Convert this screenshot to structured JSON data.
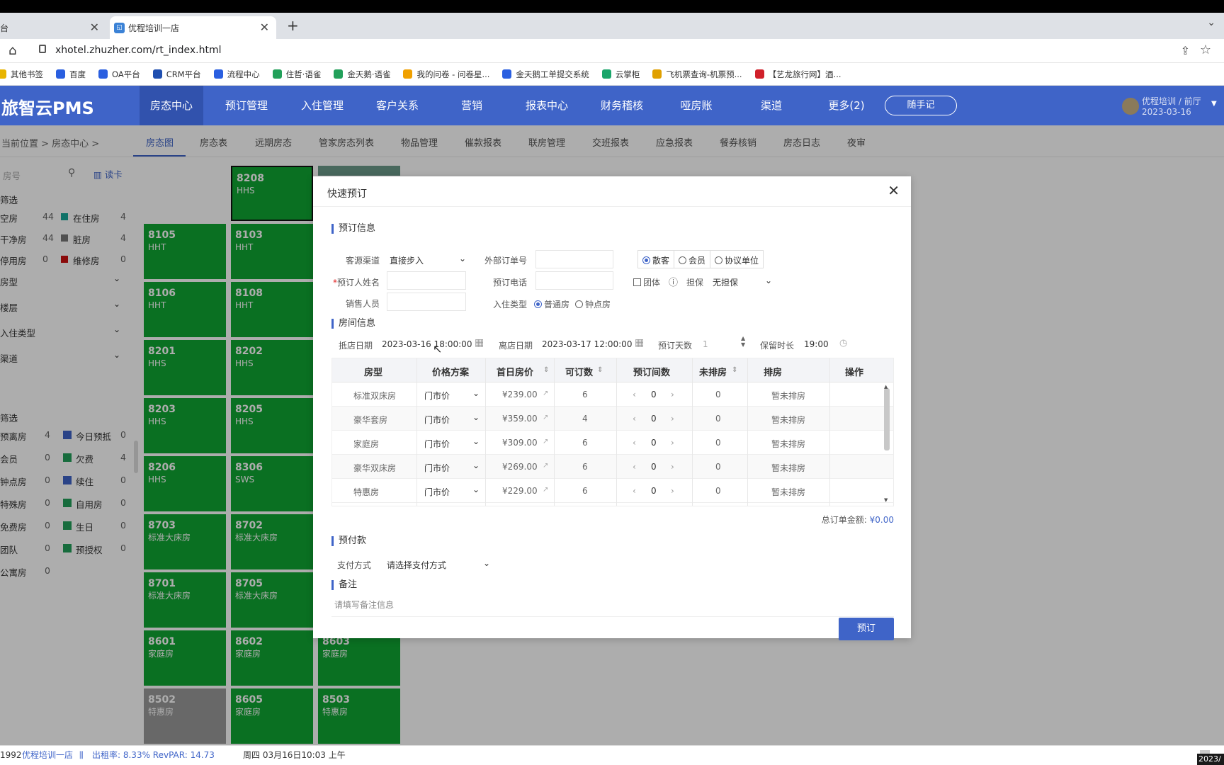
{
  "browser": {
    "tabs": [
      {
        "label": "台",
        "active": false
      },
      {
        "label": "优程培训一店",
        "active": true
      }
    ],
    "new_tab": "+",
    "url": "xhotel.zhuzher.com/rt_index.html",
    "bookmarks": [
      {
        "label": "其他书签",
        "color": "#e8b400"
      },
      {
        "label": "百度",
        "color": "#2a5fe0"
      },
      {
        "label": "OA平台",
        "color": "#2a5fe0"
      },
      {
        "label": "CRM平台",
        "color": "#1f4fb0"
      },
      {
        "label": "流程中心",
        "color": "#2a5fe0"
      },
      {
        "label": "住哲·语雀",
        "color": "#22a05a"
      },
      {
        "label": "金天鹅·语雀",
        "color": "#22a05a"
      },
      {
        "label": "我的问卷 - 问卷星...",
        "color": "#f0a000"
      },
      {
        "label": "金天鹅工单提交系统",
        "color": "#2a5fe0"
      },
      {
        "label": "云掌柜",
        "color": "#1aa56a"
      },
      {
        "label": "飞机票查询-机票预...",
        "color": "#e0a000"
      },
      {
        "label": "【艺龙旅行网】酒...",
        "color": "#d0202a"
      }
    ]
  },
  "app": {
    "logo": "旅智云PMS",
    "nav": [
      "房态中心",
      "预订管理",
      "入住管理",
      "客户关系",
      "营销",
      "报表中心",
      "财务稽核",
      "哑房账",
      "渠道",
      "更多(2)"
    ],
    "memo_button": "随手记",
    "user_name": "优程培训 / 前厅",
    "user_date": "2023-03-16",
    "breadcrumb": "当前位置 > 房态中心 >",
    "subtabs": [
      "房态图",
      "房态表",
      "远期房态",
      "管家房态列表",
      "物品管理",
      "催款报表",
      "联房管理",
      "交班报表",
      "应急报表",
      "餐券核销",
      "房态日志",
      "夜审"
    ]
  },
  "left_panel": {
    "search_placeholder": "房号",
    "card_label": "读卡",
    "filter_title": "筛选",
    "status_rows": [
      {
        "label": "空房",
        "count": "44",
        "label2": "在住房",
        "count2": "4",
        "color2": "#17a89a"
      },
      {
        "label": "干净房",
        "count": "44",
        "label2": "脏房",
        "count2": "4",
        "color2": "#777777"
      },
      {
        "label": "停用房",
        "count": "0",
        "label2": "维修房",
        "count2": "0",
        "color2": "#cc1010"
      }
    ],
    "collapse_sections": [
      "房型",
      "楼层",
      "入住类型",
      "渠道"
    ],
    "filter2_title": "筛选",
    "filter_rows": [
      {
        "label": "预离房",
        "count": "4",
        "label2": "今日预抵",
        "count2": "0"
      },
      {
        "label": "会员",
        "count": "0",
        "label2": "欠费",
        "count2": "4"
      },
      {
        "label": "钟点房",
        "count": "0",
        "label2": "续住",
        "count2": "0"
      },
      {
        "label": "特殊房",
        "count": "0",
        "label2": "自用房",
        "count2": "0"
      },
      {
        "label": "免费房",
        "count": "0",
        "label2": "生日",
        "count2": "0"
      },
      {
        "label": "团队",
        "count": "0",
        "label2": "预授权",
        "count2": "0"
      },
      {
        "label": "公寓房",
        "count": "0",
        "label2": "",
        "count2": ""
      }
    ]
  },
  "rooms": [
    {
      "no": "8208",
      "type": "HHS"
    },
    {
      "no": "8105",
      "type": "HHT"
    },
    {
      "no": "8103",
      "type": "HHT"
    },
    {
      "no": "8106",
      "type": "HHT"
    },
    {
      "no": "8108",
      "type": "HHT"
    },
    {
      "no": "8201",
      "type": "HHS"
    },
    {
      "no": "8202",
      "type": "HHS"
    },
    {
      "no": "8203",
      "type": "HHS"
    },
    {
      "no": "8205",
      "type": "HHS"
    },
    {
      "no": "8206",
      "type": "HHS"
    },
    {
      "no": "8306",
      "type": "SWS"
    },
    {
      "no": "8703",
      "type": "标准大床房"
    },
    {
      "no": "8702",
      "type": "标准大床房"
    },
    {
      "no": "8701",
      "type": "标准大床房"
    },
    {
      "no": "8705",
      "type": "标准大床房"
    },
    {
      "no": "8601",
      "type": "家庭房"
    },
    {
      "no": "8602",
      "type": "家庭房"
    },
    {
      "no": "8603",
      "type": "家庭房"
    },
    {
      "no": "8502",
      "type": "特惠房"
    },
    {
      "no": "8605",
      "type": "家庭房"
    },
    {
      "no": "8503",
      "type": "特惠房"
    }
  ],
  "dialog": {
    "title": "快速预订",
    "sec_booking": "预订信息",
    "source_label": "客源渠道",
    "source_value": "直接步入",
    "ext_order_label": "外部订单号",
    "guest_types": [
      "散客",
      "会员",
      "协议单位"
    ],
    "booker_label": "预订人姓名",
    "phone_label": "预订电话",
    "group_label": "团体",
    "guarantee_label": "担保",
    "guarantee_value": "无担保",
    "sales_label": "销售人员",
    "checkin_type_label": "入住类型",
    "checkin_types": [
      "普通房",
      "钟点房"
    ],
    "sec_room": "房间信息",
    "arrive_label": "抵店日期",
    "arrive_value": "2023-03-16 18:00:00",
    "depart_label": "离店日期",
    "depart_value": "2023-03-17 12:00:00",
    "days_label": "预订天数",
    "days_value": "1",
    "hold_label": "保留时长",
    "hold_value": "19:00",
    "columns": [
      "房型",
      "价格方案",
      "首日房价",
      "可订数",
      "预订间数",
      "未排房",
      "排房",
      "操作"
    ],
    "rows": [
      {
        "type": "标准双床房",
        "plan": "门市价",
        "price": "¥239.00",
        "avail": "6",
        "qty": "0",
        "unassigned": "0",
        "assign": "暂未排房"
      },
      {
        "type": "豪华套房",
        "plan": "门市价",
        "price": "¥359.00",
        "avail": "4",
        "qty": "0",
        "unassigned": "0",
        "assign": "暂未排房"
      },
      {
        "type": "家庭房",
        "plan": "门市价",
        "price": "¥309.00",
        "avail": "6",
        "qty": "0",
        "unassigned": "0",
        "assign": "暂未排房"
      },
      {
        "type": "豪华双床房",
        "plan": "门市价",
        "price": "¥269.00",
        "avail": "6",
        "qty": "0",
        "unassigned": "0",
        "assign": "暂未排房"
      },
      {
        "type": "特惠房",
        "plan": "门市价",
        "price": "¥229.00",
        "avail": "6",
        "qty": "0",
        "unassigned": "0",
        "assign": "暂未排房"
      }
    ],
    "total_label": "总订单金额:",
    "total_value": "¥0.00",
    "sec_payment": "预付款",
    "pay_label": "支付方式",
    "pay_value": "请选择支付方式",
    "sec_remark": "备注",
    "remark_placeholder": "请填写备注信息",
    "book_button": "预订"
  },
  "statusbar": {
    "id": "1992",
    "hotel": "优程培训一店",
    "occupancy": "出租率: 8.33% RevPAR: 14.73",
    "datetime": "周四 03月16日10:03 上午",
    "clock": "2023/"
  }
}
